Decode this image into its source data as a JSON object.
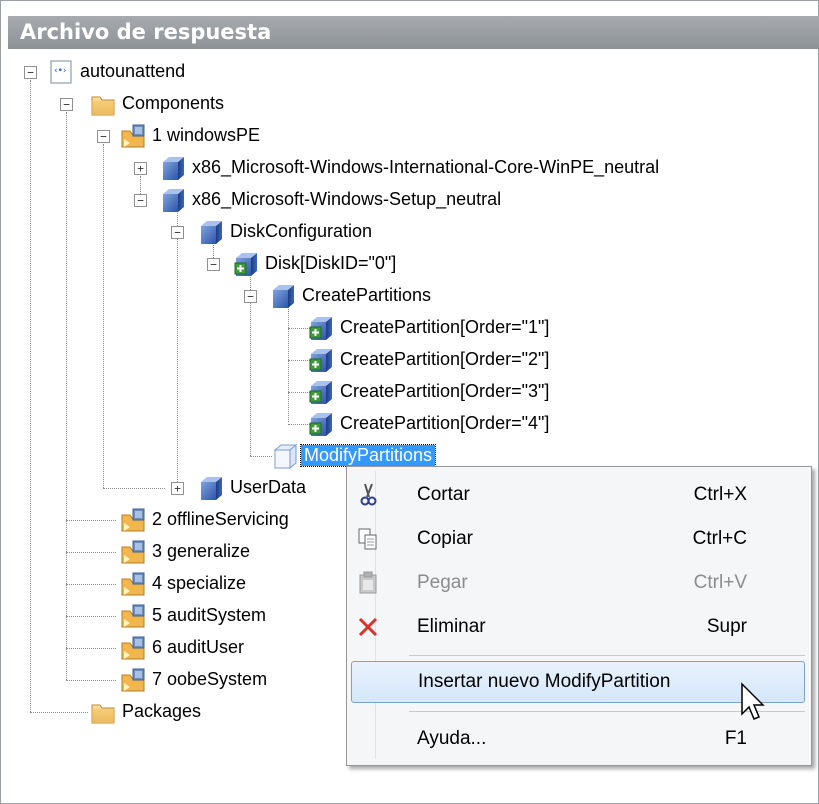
{
  "panel": {
    "title": "Archivo de respuesta"
  },
  "tree": {
    "root": "autounattend",
    "components": "Components",
    "pass1": "1 windowsPE",
    "intl": "x86_Microsoft-Windows-International-Core-WinPE_neutral",
    "setup": "x86_Microsoft-Windows-Setup_neutral",
    "diskconfig": "DiskConfiguration",
    "disk": "Disk[DiskID=\"0\"]",
    "createparts": "CreatePartitions",
    "cp1": "CreatePartition[Order=\"1\"]",
    "cp2": "CreatePartition[Order=\"2\"]",
    "cp3": "CreatePartition[Order=\"3\"]",
    "cp4": "CreatePartition[Order=\"4\"]",
    "modify": "ModifyPartitions",
    "userdata": "UserData",
    "pass2": "2 offlineServicing",
    "pass3": "3 generalize",
    "pass4": "4 specialize",
    "pass5": "5 auditSystem",
    "pass6": "6 auditUser",
    "pass7": "7 oobeSystem",
    "packages": "Packages"
  },
  "context_menu": {
    "cut": {
      "label": "Cortar",
      "shortcut": "Ctrl+X",
      "icon": "scissors-icon"
    },
    "copy": {
      "label": "Copiar",
      "shortcut": "Ctrl+C",
      "icon": "copy-icon"
    },
    "paste": {
      "label": "Pegar",
      "shortcut": "Ctrl+V",
      "icon": "paste-icon",
      "disabled": true
    },
    "delete": {
      "label": "Eliminar",
      "shortcut": "Supr",
      "icon": "delete-x-icon"
    },
    "insert": {
      "label": "Insertar nuevo ModifyPartition"
    },
    "help": {
      "label": "Ayuda...",
      "shortcut": "F1"
    }
  },
  "colors": {
    "selection": "#3399ff",
    "menu_highlight": "#d4e7fb",
    "titlebar": "#9a9ea2"
  }
}
